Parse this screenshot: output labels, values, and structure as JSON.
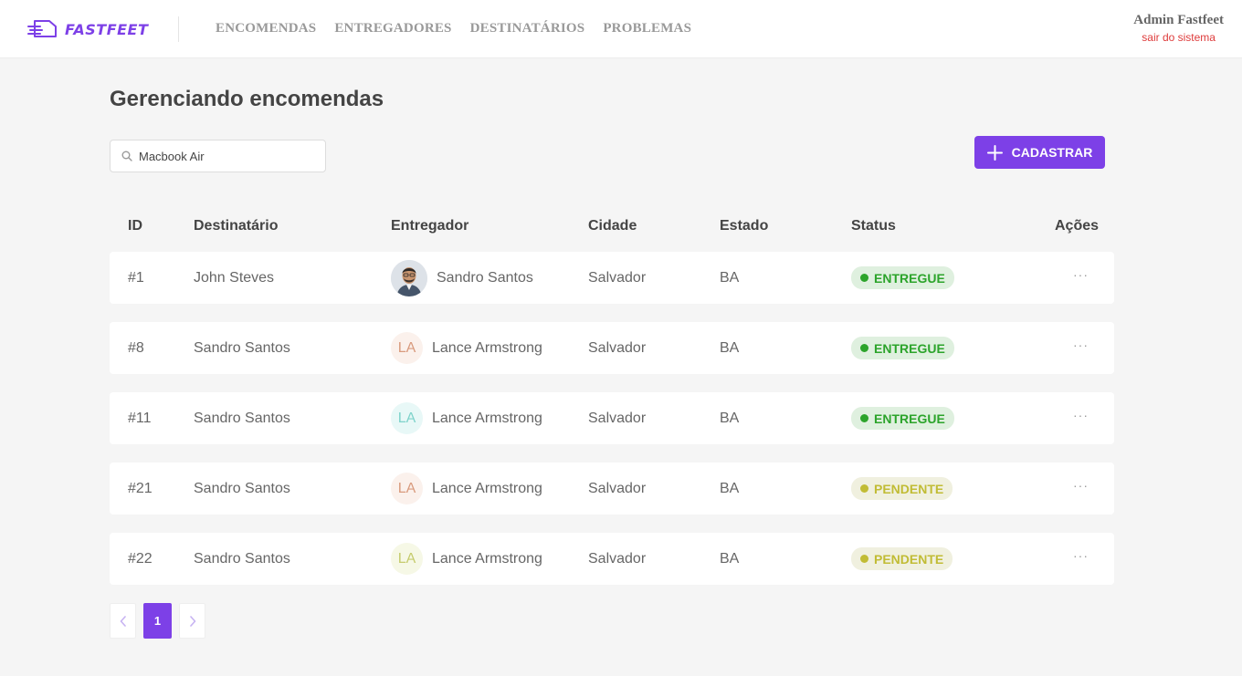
{
  "header": {
    "logo_text": "FASTFEET",
    "nav": [
      "ENCOMENDAS",
      "ENTREGADORES",
      "DESTINATÁRIOS",
      "PROBLEMAS"
    ],
    "user_name": "Admin Fastfeet",
    "logout": "sair do sistema"
  },
  "page": {
    "title": "Gerenciando encomendas",
    "search_value": "Macbook Air",
    "add_button": "CADASTRAR"
  },
  "table": {
    "columns": [
      "ID",
      "Destinatário",
      "Entregador",
      "Cidade",
      "Estado",
      "Status",
      "Ações"
    ],
    "rows": [
      {
        "id": "#1",
        "recipient": "John Steves",
        "courier": "Sandro Santos",
        "courier_initials": "",
        "city": "Salvador",
        "state": "BA",
        "status": "ENTREGUE",
        "actions": "···"
      },
      {
        "id": "#8",
        "recipient": "Sandro Santos",
        "courier": "Lance Armstrong",
        "courier_initials": "LA",
        "city": "Salvador",
        "state": "BA",
        "status": "ENTREGUE",
        "actions": "···"
      },
      {
        "id": "#11",
        "recipient": "Sandro Santos",
        "courier": "Lance Armstrong",
        "courier_initials": "LA",
        "city": "Salvador",
        "state": "BA",
        "status": "ENTREGUE",
        "actions": "···"
      },
      {
        "id": "#21",
        "recipient": "Sandro Santos",
        "courier": "Lance Armstrong",
        "courier_initials": "LA",
        "city": "Salvador",
        "state": "BA",
        "status": "PENDENTE",
        "actions": "···"
      },
      {
        "id": "#22",
        "recipient": "Sandro Santos",
        "courier": "Lance Armstrong",
        "courier_initials": "LA",
        "city": "Salvador",
        "state": "BA",
        "status": "PENDENTE",
        "actions": "···"
      }
    ]
  },
  "pagination": {
    "current": "1"
  },
  "colors": {
    "brand": "#7d40e7",
    "logout": "#de3b3b",
    "entregue_text": "#2ca42b",
    "entregue_bg": "#dff0df",
    "pendente_text": "#c1bc35",
    "pendente_bg": "#f0f0df"
  },
  "icons": [
    "truck-logo-icon",
    "search-icon",
    "plus-icon",
    "more-icon",
    "chevron-left-icon",
    "chevron-right-icon"
  ]
}
